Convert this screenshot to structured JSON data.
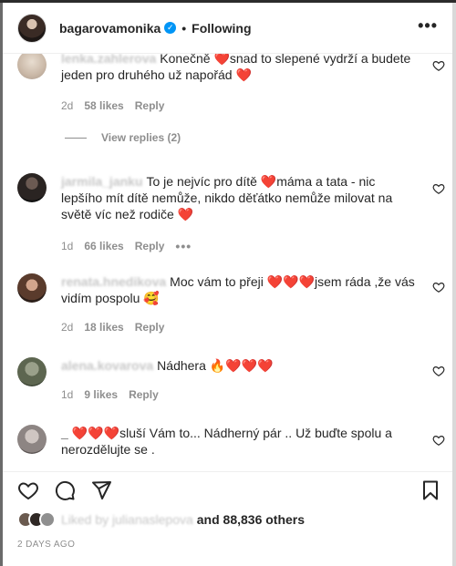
{
  "header": {
    "username": "bagarovamonika",
    "follow_status": "Following"
  },
  "comments": [
    {
      "username": "lenka.zahlerova",
      "text": "Konečně ❤️snad to slepené vydrží a budete jeden pro druhého už napořád ❤️",
      "age": "2d",
      "likes": "58 likes",
      "reply_label": "Reply",
      "view_replies": "View replies (2)"
    },
    {
      "username": "jarmila_janku",
      "text": "To je nejvíc pro dítě ❤️máma a tata - nic lepšího mít dítě nemůže, nikdo děťátko nemůže milovat na světě víc než rodiče ❤️",
      "age": "1d",
      "likes": "66 likes",
      "reply_label": "Reply"
    },
    {
      "username": "renata.hnedikova",
      "text": "Moc vám to přeji ❤️❤️❤️jsem ráda ,že vás vidím pospolu 🥰",
      "age": "2d",
      "likes": "18 likes",
      "reply_label": "Reply"
    },
    {
      "username": "alena.kovarova",
      "text": "Nádhera 🔥❤️❤️❤️",
      "age": "1d",
      "likes": "9 likes",
      "reply_label": "Reply"
    },
    {
      "username": "_",
      "text": "❤️❤️❤️sluší Vám to... Nádherný pár .. Už buďte spolu a nerozdělujte se ."
    }
  ],
  "likes_summary": {
    "liked_by": "Liked by julianaslepova",
    "and_others": "and 88,836 others"
  },
  "timestamp": "2 DAYS AGO",
  "icons": {
    "heart": "heart-icon",
    "comment": "comment-icon",
    "share": "send-icon",
    "save": "bookmark-icon",
    "more": "more-icon"
  },
  "colors": {
    "text": "#262626",
    "secondary": "#8e8e8e",
    "verified": "#0095f6",
    "divider": "#efefef"
  }
}
